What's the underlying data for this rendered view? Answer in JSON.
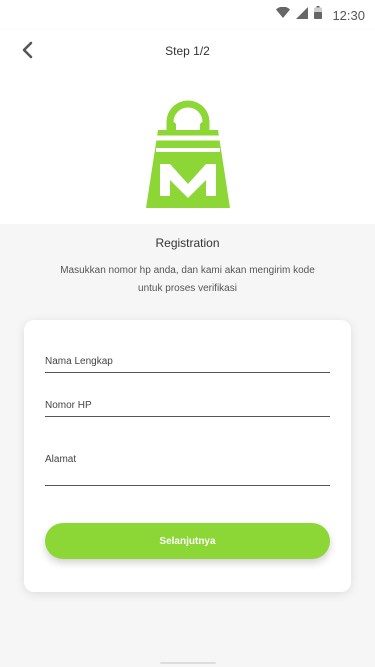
{
  "status_bar": {
    "time": "12:30",
    "icons": [
      "wifi-icon",
      "signal-icon",
      "battery-icon"
    ]
  },
  "header": {
    "back_icon": "chevron-left-icon",
    "title": "Step 1/2"
  },
  "logo": {
    "icon": "shopping-bag-m-icon",
    "color": "#8cd635"
  },
  "registration": {
    "title": "Registration",
    "description": "Masukkan nomor hp anda, dan kami akan mengirim kode untuk proses verifikasi"
  },
  "form": {
    "nama_placeholder": "Nama Lengkap",
    "hp_placeholder": "Nomor HP",
    "alamat_placeholder": "Alamat",
    "submit_label": "Selanjutnya"
  },
  "colors": {
    "accent": "#8cd635",
    "background": "#f6f6f6"
  }
}
